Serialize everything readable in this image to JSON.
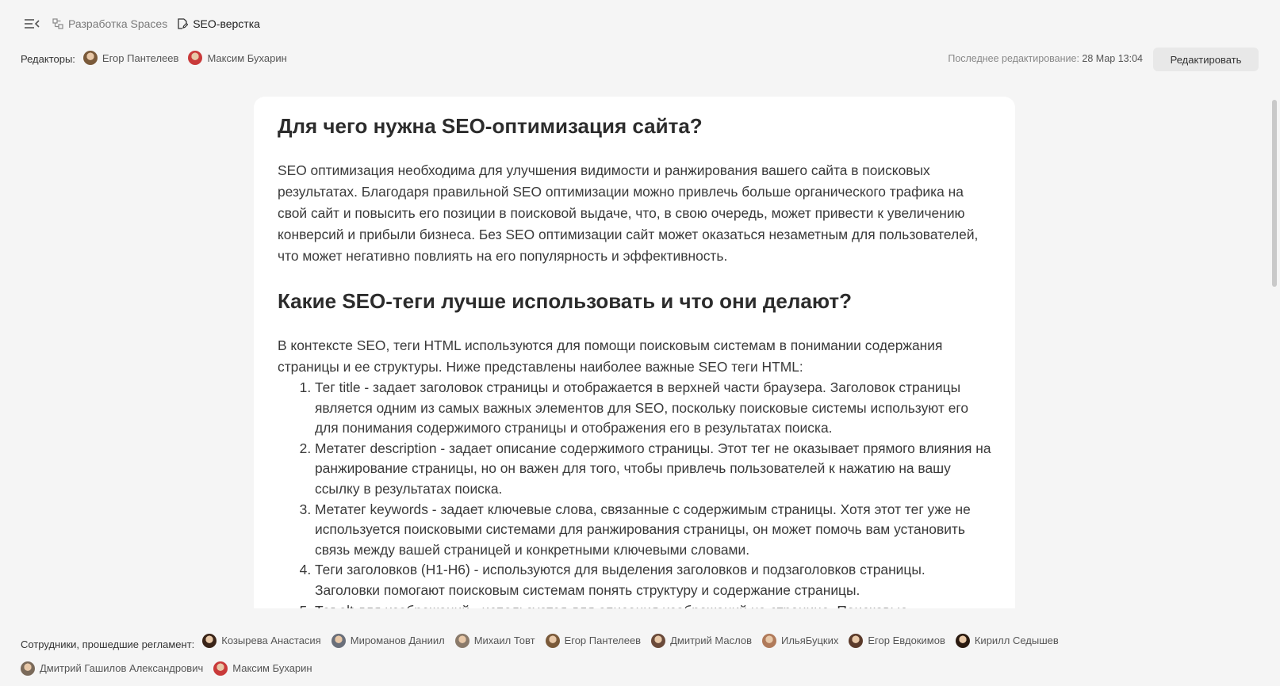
{
  "breadcrumbs": {
    "space": "Разработка Spaces",
    "page": "SEO-верстка"
  },
  "editors": {
    "label": "Редакторы:",
    "people": [
      {
        "name": "Егор Пантелеев",
        "color": "#7a5a3a"
      },
      {
        "name": "Максим Бухарин",
        "color": "#c93a3a"
      }
    ]
  },
  "last_edit": {
    "label": "Последнее редактирование:",
    "value": "28 Мар 13:04"
  },
  "edit_button": "Редактировать",
  "article": {
    "heading1": "Для чего нужна SEO-оптимизация сайта?",
    "para1": "SEO оптимизация необходима для улучшения видимости и ранжирования вашего сайта в поисковых результатах. Благодаря правильной SEO оптимизации можно привлечь больше органического трафика на свой сайт и повысить его позиции в поисковой выдаче, что, в свою очередь, может привести к увеличению конверсий и прибыли бизнеса. Без SEO оптимизации сайт может оказаться незаметным для пользователей, что может негативно повлиять на его популярность и эффективность.",
    "heading2": "Какие SEO-теги лучше использовать и что они делают?",
    "para2": "В контексте SEO, теги HTML используются для помощи поисковым системам в понимании содержания страницы и ее структуры. Ниже представлены наиболее важные SEO теги HTML:",
    "list": [
      "Тег title - задает заголовок страницы и отображается в верхней части браузера. Заголовок страницы является одним из самых важных элементов для SEO, поскольку поисковые системы используют его для понимания содержимого страницы и отображения его в результатах поиска.",
      "Метатег description - задает описание содержимого страницы. Этот тег не оказывает прямого влияния на ранжирование страницы, но он важен для того, чтобы привлечь пользователей к нажатию на вашу ссылку в результатах поиска.",
      "Метатег keywords - задает ключевые слова, связанные с содержимым страницы. Хотя этот тег уже не используется поисковыми системами для ранжирования страницы, он может помочь вам установить связь между вашей страницей и конкретными ключевыми словами.",
      "Теги заголовков (H1-H6) - используются для выделения заголовков и подзаголовков страницы. Заголовки помогают поисковым системам понять структуру и содержание страницы.",
      "Тег alt для изображений - используется для описания изображений на странице. Поисковые"
    ]
  },
  "staff": {
    "label": "Сотрудники, прошедшие регламент:",
    "people": [
      {
        "name": "Козырева Анастасия",
        "color": "#3a2418"
      },
      {
        "name": "Мироманов Даниил",
        "color": "#6a6f7a"
      },
      {
        "name": "Михаил Товт",
        "color": "#8a7a6a"
      },
      {
        "name": "Егор Пантелеев",
        "color": "#7a5a3a"
      },
      {
        "name": "Дмитрий Маслов",
        "color": "#6a4a3a"
      },
      {
        "name": "ИльяБуцких",
        "color": "#b07a5a"
      },
      {
        "name": "Егор Евдокимов",
        "color": "#5a3a2a"
      },
      {
        "name": "Кирилл Седышев",
        "color": "#2a1a10"
      },
      {
        "name": "Дмитрий Гашилов Александрович",
        "color": "#7a6a5a"
      },
      {
        "name": "Максим Бухарин",
        "color": "#c93a3a"
      }
    ]
  }
}
